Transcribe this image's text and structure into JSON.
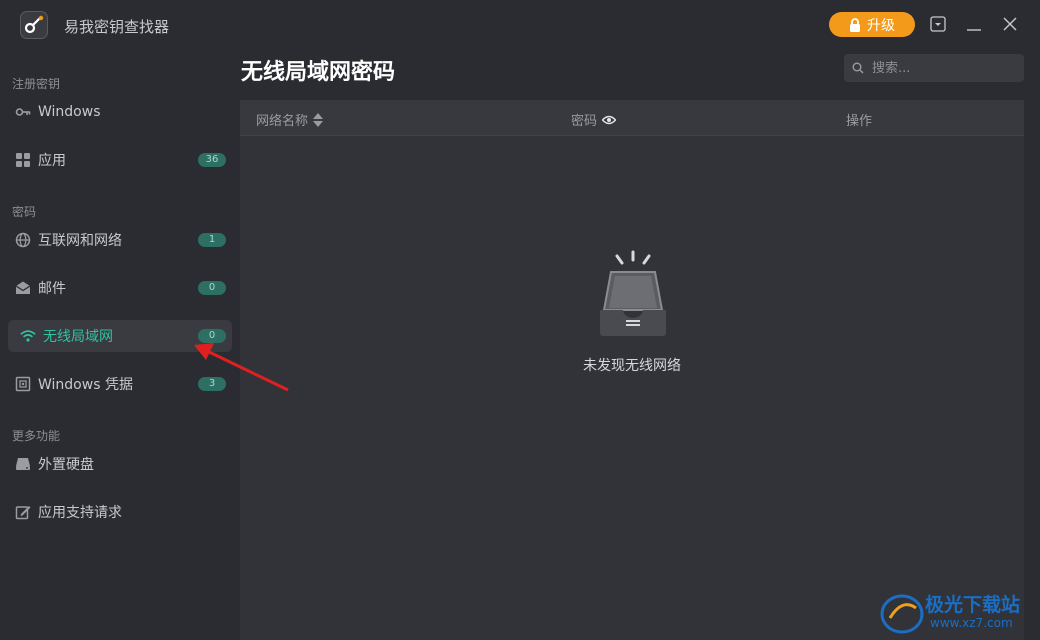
{
  "app": {
    "title": "易我密钥查找器",
    "upgrade_label": "升级"
  },
  "sidebar": {
    "sections": [
      {
        "label": "注册密钥"
      },
      {
        "label": "密码"
      },
      {
        "label": "更多功能"
      }
    ],
    "items": [
      {
        "label": "Windows",
        "icon": "key-icon"
      },
      {
        "label": "应用",
        "badge": "36",
        "icon": "apps-grid-icon"
      },
      {
        "label": "互联网和网络",
        "badge": "1",
        "icon": "globe-icon"
      },
      {
        "label": "邮件",
        "badge": "0",
        "icon": "mail-icon"
      },
      {
        "label": "无线局域网",
        "badge": "0",
        "icon": "wifi-icon",
        "active": true
      },
      {
        "label": "Windows 凭据",
        "badge": "3",
        "icon": "safe-icon"
      },
      {
        "label": "外置硬盘",
        "icon": "hard-drive-icon"
      },
      {
        "label": "应用支持请求",
        "icon": "edit-icon"
      }
    ]
  },
  "main": {
    "title": "无线局域网密码",
    "search_placeholder": "搜索...",
    "columns": [
      "网络名称",
      "密码",
      "操作"
    ],
    "empty_text": "未发现无线网络"
  },
  "watermark": {
    "name": "极光下载站",
    "url": "www.xz7.com"
  },
  "colors": {
    "accent": "#2fc2a0",
    "upgrade": "#f39a1b",
    "background": "#2b2c31",
    "arrow": "#e02020"
  }
}
